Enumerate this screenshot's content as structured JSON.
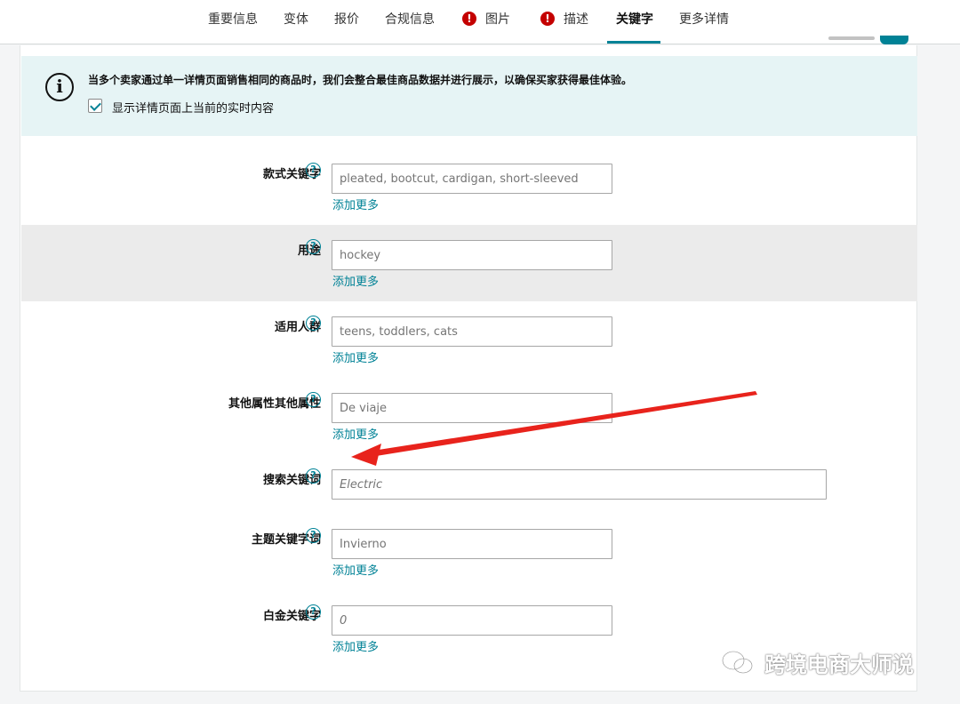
{
  "tabs": [
    {
      "label": "重要信息",
      "alert": false,
      "active": false
    },
    {
      "label": "变体",
      "alert": false,
      "active": false
    },
    {
      "label": "报价",
      "alert": false,
      "active": false
    },
    {
      "label": "合规信息",
      "alert": false,
      "active": false
    },
    {
      "label": "图片",
      "alert": true,
      "active": false
    },
    {
      "label": "描述",
      "alert": true,
      "active": false
    },
    {
      "label": "关键字",
      "alert": false,
      "active": true
    },
    {
      "label": "更多详情",
      "alert": false,
      "active": false
    }
  ],
  "info": {
    "message": "当多个卖家通过单一详情页面销售相同的商品时，我们会整合最佳商品数据并进行展示，以确保买家获得最佳体验。",
    "checkbox_label": "显示详情页面上当前的实时内容",
    "checked": true
  },
  "fields": [
    {
      "label": "款式关键字",
      "placeholder": "pleated, bootcut, cardigan, short-sleeved",
      "add_more": "添加更多"
    },
    {
      "label": "用途",
      "placeholder": "hockey",
      "add_more": "添加更多"
    },
    {
      "label": "适用人群",
      "placeholder": "teens, toddlers, cats",
      "add_more": "添加更多"
    },
    {
      "label": "其他属性其他属性",
      "placeholder": "De viaje",
      "add_more": "添加更多"
    },
    {
      "label": "搜索关键词",
      "placeholder": "Electric",
      "add_more": ""
    },
    {
      "label": "主题关键字词",
      "placeholder": "Invierno",
      "add_more": "添加更多"
    },
    {
      "label": "白金关键字",
      "placeholder": "0",
      "add_more": "添加更多"
    }
  ],
  "help_glyph": "?",
  "info_glyph": "i",
  "watermark": "跨境电商大师说",
  "colors": {
    "accent": "#008296",
    "alert": "#c40000",
    "info_bg": "#e6f4f5",
    "annotation_arrow": "#e8231c"
  }
}
